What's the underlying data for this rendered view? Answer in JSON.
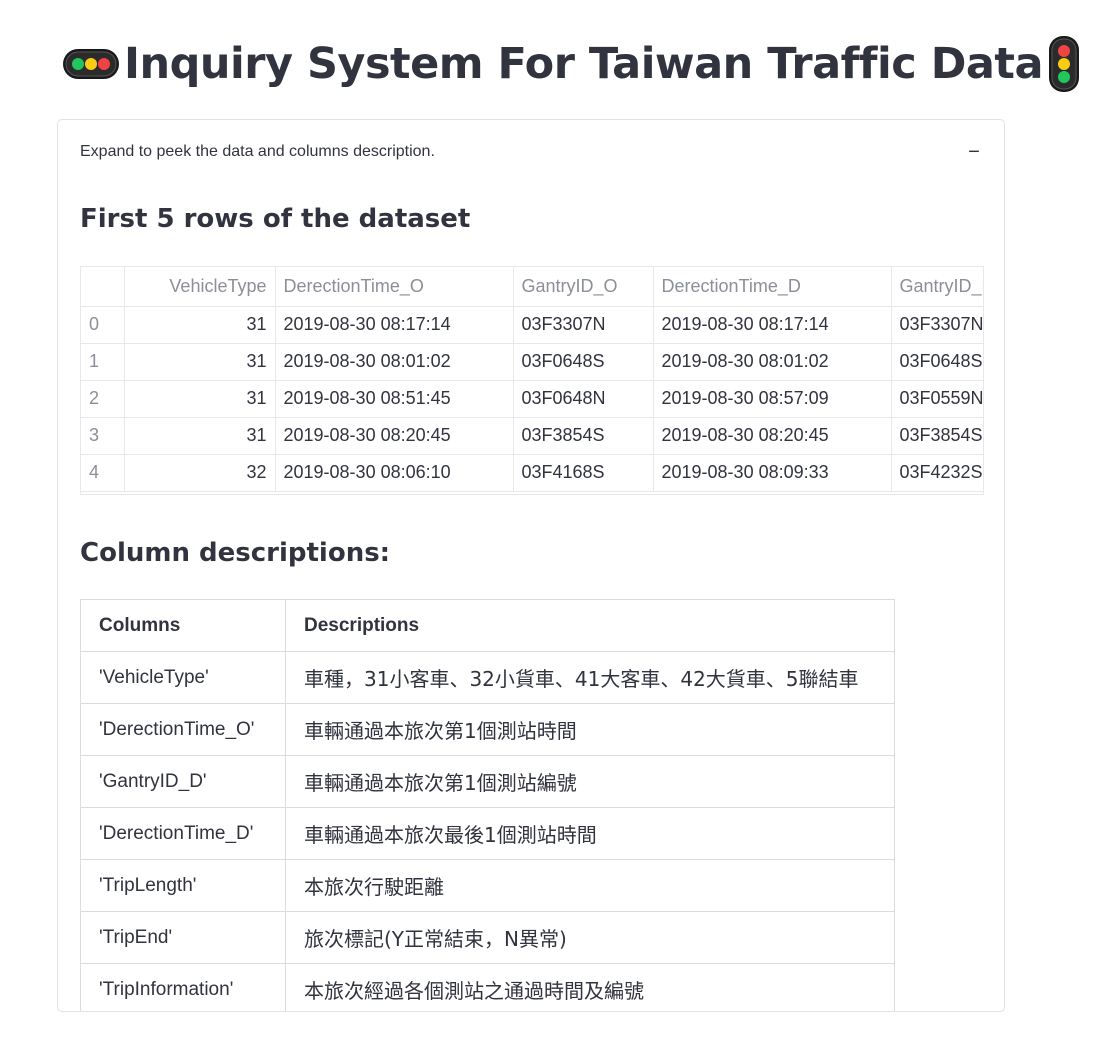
{
  "title": {
    "text": "Inquiry System For Taiwan Traffic Data",
    "left_icon": "horizontal-traffic-light-icon",
    "right_icon": "vertical-traffic-light-icon"
  },
  "expander": {
    "label": "Expand to peek the data and columns description.",
    "toggle": "−",
    "expanded": true
  },
  "dataset_heading": "First 5 rows of the dataset",
  "dataframe": {
    "columns": [
      "",
      "VehicleType",
      "DerectionTime_O",
      "GantryID_O",
      "DerectionTime_D",
      "GantryID_D"
    ],
    "rows": [
      [
        "0",
        "31",
        "2019-08-30 08:17:14",
        "03F3307N",
        "2019-08-30 08:17:14",
        "03F3307N"
      ],
      [
        "1",
        "31",
        "2019-08-30 08:01:02",
        "03F0648S",
        "2019-08-30 08:01:02",
        "03F0648S"
      ],
      [
        "2",
        "31",
        "2019-08-30 08:51:45",
        "03F0648N",
        "2019-08-30 08:57:09",
        "03F0559N"
      ],
      [
        "3",
        "31",
        "2019-08-30 08:20:45",
        "03F3854S",
        "2019-08-30 08:20:45",
        "03F3854S"
      ],
      [
        "4",
        "32",
        "2019-08-30 08:06:10",
        "03F4168S",
        "2019-08-30 08:09:33",
        "03F4232S"
      ]
    ]
  },
  "columns_heading": "Column descriptions:",
  "desc_table": {
    "headers": [
      "Columns",
      "Descriptions"
    ],
    "rows": [
      [
        "'VehicleType'",
        "車種，31小客車、32小貨車、41大客車、42大貨車、5聯結車"
      ],
      [
        "'DerectionTime_O'",
        "車輛通過本旅次第1個測站時間"
      ],
      [
        "'GantryID_D'",
        "車輛通過本旅次第1個測站編號"
      ],
      [
        "'DerectionTime_D'",
        "車輛通過本旅次最後1個測站時間"
      ],
      [
        "'TripLength'",
        "本旅次行駛距離"
      ],
      [
        "'TripEnd'",
        "旅次標記(Y正常結束，N異常)"
      ],
      [
        "'TripInformation'",
        "本旅次經過各個測站之通過時間及編號"
      ]
    ]
  }
}
